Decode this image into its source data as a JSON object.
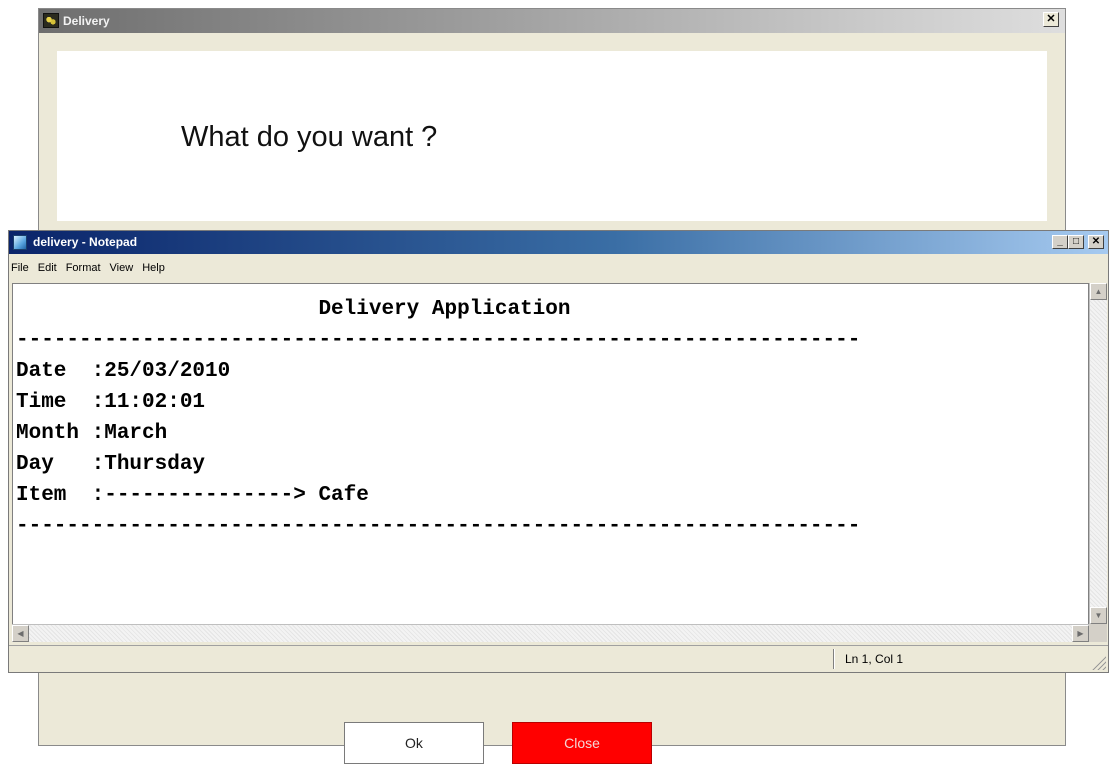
{
  "delivery_dialog": {
    "title": "Delivery",
    "close_glyph": "✕",
    "question": "What do you want ?",
    "ok_label": "Ok",
    "close_label": "Close",
    "close_color": "#ff0000"
  },
  "notepad": {
    "title": "delivery - Notepad",
    "menu": [
      "File",
      "Edit",
      "Format",
      "View",
      "Help"
    ],
    "controls": {
      "minimize": "_",
      "maximize": "□",
      "close": "✕"
    },
    "content_lines": [
      "                        Delivery Application",
      "-------------------------------------------------------------------",
      "Date  :25/03/2010",
      "Time  :11:02:01",
      "Month :March",
      "Day   :Thursday",
      "Item  :---------------> Cafe",
      "-------------------------------------------------------------------"
    ],
    "status_position": "Ln 1, Col 1"
  },
  "icons": {
    "delivery_app": "delivery-app-icon",
    "notepad_app": "notepad-icon"
  }
}
